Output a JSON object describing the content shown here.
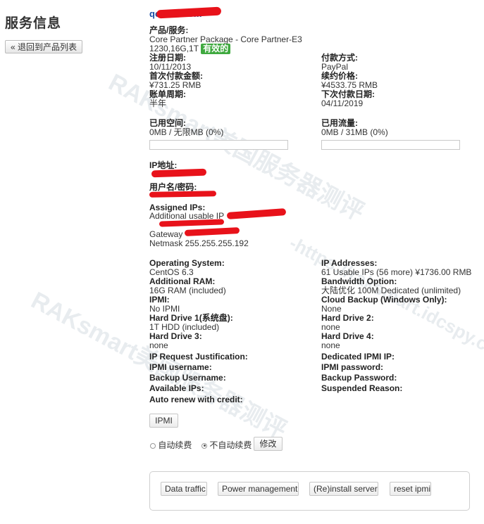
{
  "page": {
    "title": "服务信息",
    "back_label": "« 退回到产品列表"
  },
  "product": {
    "domain": "qc.........com",
    "product_label": "产品/服务:",
    "product_name_line1": "Core Partner Package - Core Partner-E3",
    "product_name_line2": "1230,16G,1T",
    "status": "有效的",
    "reg_date_label": "注册日期:",
    "reg_date": "10/11/2013",
    "first_amount_label": "首次付款金额:",
    "first_amount": "¥731.25 RMB",
    "billing_cycle_label": "账单周期:",
    "billing_cycle": "半年",
    "payment_method_label": "付款方式:",
    "payment_method": "PayPal",
    "renew_price_label": "续约价格:",
    "renew_price": "¥4533.75 RMB",
    "next_due_label": "下次付款日期:",
    "next_due": "04/11/2019"
  },
  "usage": {
    "disk_label": "已用空间:",
    "disk_value": "0MB / 无限MB (0%)",
    "disk_percent": 0,
    "bw_label": "已用流量:",
    "bw_value": "0MB / 31MB (0%)",
    "bw_percent": 0
  },
  "network": {
    "ip_label": "IP地址:",
    "user_pass_label": "用户名/密码:",
    "assigned_label": "Assigned IPs:",
    "additional_ip": "Additional usable IP",
    "gateway": "Gateway",
    "netmask": "Netmask 255.255.255.192"
  },
  "config": {
    "left": [
      {
        "label": "Operating System:",
        "value": "CentOS 6.3"
      },
      {
        "label": "Additional RAM:",
        "value": "16G RAM (included)"
      },
      {
        "label": "IPMI:",
        "value": "No IPMI"
      },
      {
        "label": "Hard Drive 1(系统盘):",
        "value": "1T HDD (included)"
      },
      {
        "label": "Hard Drive 3:",
        "value": "none"
      }
    ],
    "right": [
      {
        "label": "IP Addresses:",
        "value": "61 Usable IPs (56 more) ¥1736.00 RMB"
      },
      {
        "label": "Bandwidth Option:",
        "value": "大陆优化 100M Dedicated (unlimited)"
      },
      {
        "label": "Cloud Backup (Windows Only):",
        "value": "None"
      },
      {
        "label": "Hard Drive 2:",
        "value": "none"
      },
      {
        "label": "Hard Drive 4:",
        "value": "none"
      }
    ]
  },
  "extra_fields": {
    "left": [
      "IP Request Justification:",
      "IPMI username:",
      "Backup Username:",
      "Available IPs:",
      "Auto renew with credit:"
    ],
    "right": [
      "Dedicated IPMI IP:",
      "IPMI password:",
      "Backup Password:",
      "Suspended Reason:"
    ]
  },
  "actions": {
    "ipmi_button": "IPMI",
    "auto_renew_label": "自动续费",
    "no_auto_renew_label": "不自动续费",
    "modify_button": "修改",
    "panel_buttons": [
      "Data traffic",
      "Power management",
      "(Re)install server",
      "reset ipmi"
    ]
  },
  "watermark": {
    "brand": "RAKsmart美国服务器测评",
    "url": "-https://raksmart.idcspy.com/-"
  },
  "colors": {
    "status_green": "#3fa93f",
    "domain_blue": "#1a4ea6",
    "redaction": "#e8121a"
  }
}
